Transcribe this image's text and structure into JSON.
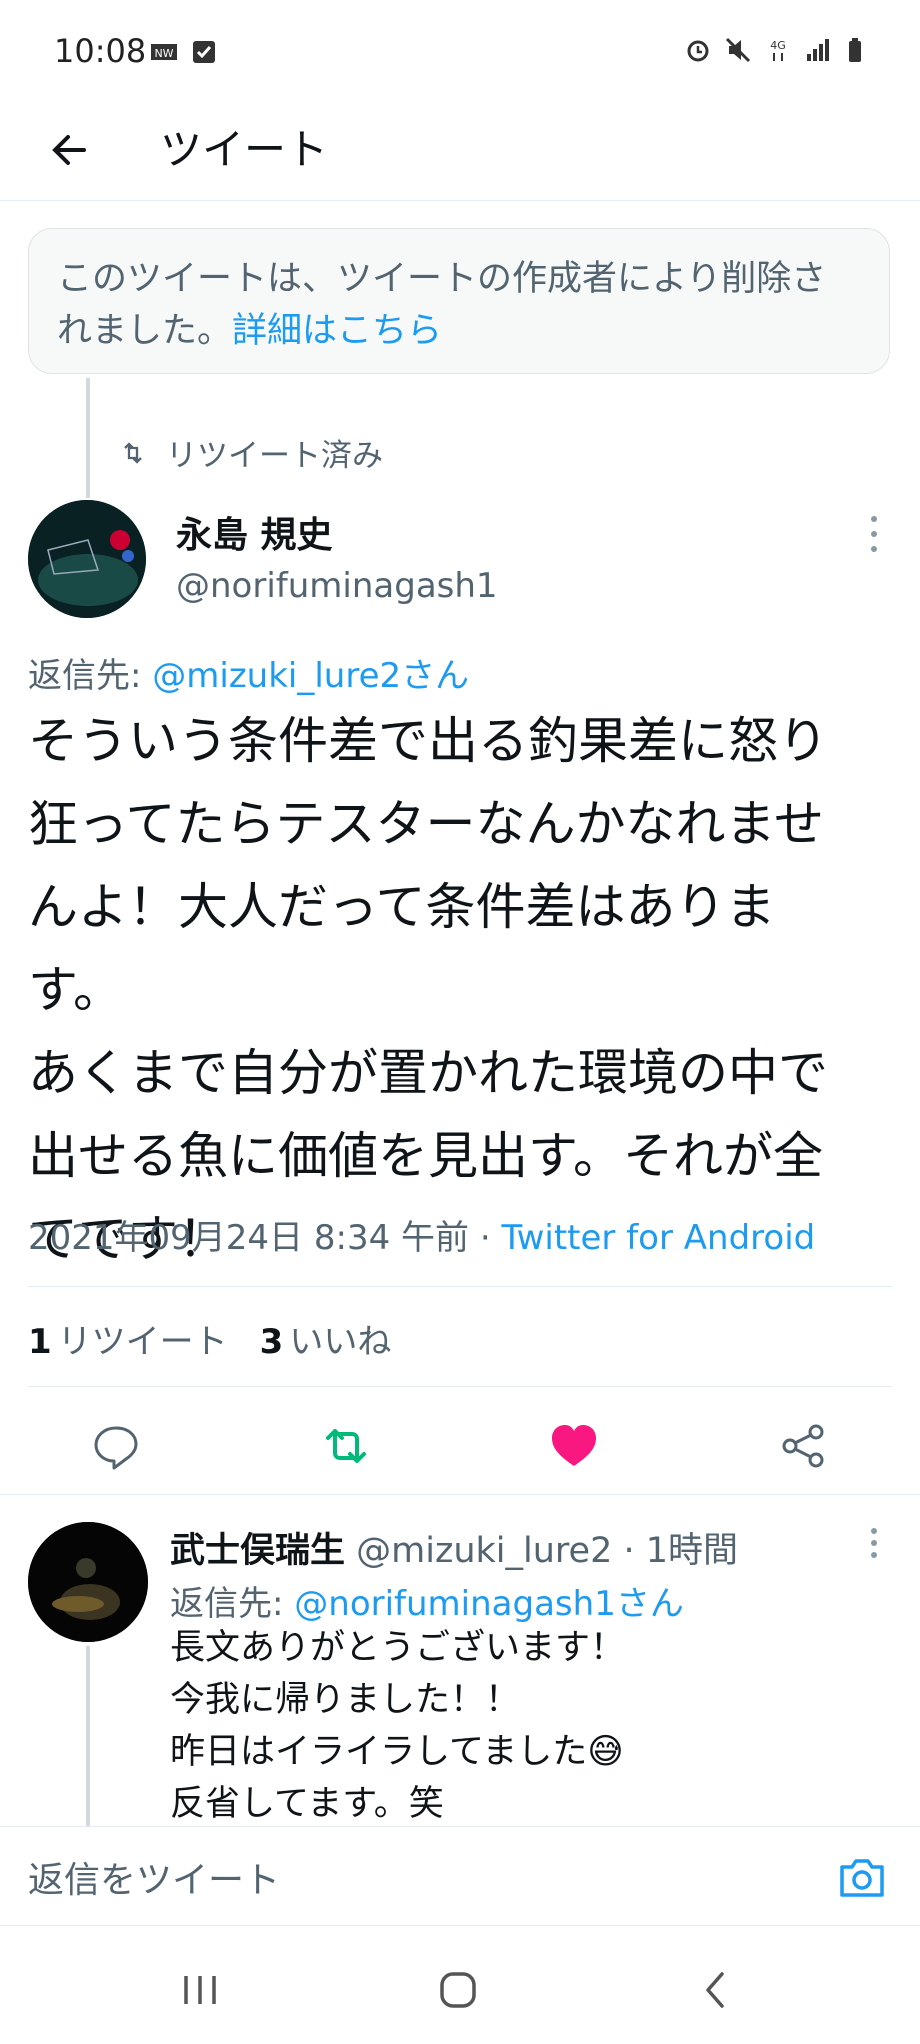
{
  "status_bar": {
    "time": "10:08",
    "left_icons": [
      "nw-icon",
      "check-icon"
    ],
    "right_icons": [
      "alarm-icon",
      "mute-icon",
      "4g-icon",
      "signal-icon",
      "battery-icon"
    ]
  },
  "app_bar": {
    "title": "ツイート"
  },
  "deleted_notice": {
    "text": "このツイートは、ツイートの作成者により削除されました。",
    "link": "詳細はこちら"
  },
  "retweet_label": "リツイート済み",
  "tweet": {
    "name": "永島 規史",
    "handle": "@norifuminagash1",
    "reply_to_prefix": "返信先: ",
    "reply_to": "@mizuki_lure2さん",
    "text": "そういう条件差で出る釣果差に怒り\n狂ってたらテスターなんかなれませ\nんよ！大人だって条件差はありま\nす。\nあくまで自分が置かれた環境の中で\n出せる魚に価値を見出す。それが全\nてです！",
    "date": "2021年09月24日 8:34 午前 · ",
    "source": "Twitter for Android",
    "retweets_count": "1",
    "retweets_label": "リツイート",
    "likes_count": "3",
    "likes_label": "いいね"
  },
  "reply": {
    "name": "武士俣瑞生",
    "handle_time": " @mizuki_lure2 · 1時間",
    "reply_to_prefix": "返信先: ",
    "reply_to": "@norifuminagash1さん",
    "text": "長文ありがとうございます！\n今我に帰りました！！\n昨日はイライラしてました😅\n反省してます。笑"
  },
  "compose": {
    "placeholder": "返信をツイート"
  },
  "colors": {
    "accent": "#1d9bf0",
    "retweet_green": "#00ba7c",
    "like_red": "#f91880",
    "muted": "#536471"
  }
}
